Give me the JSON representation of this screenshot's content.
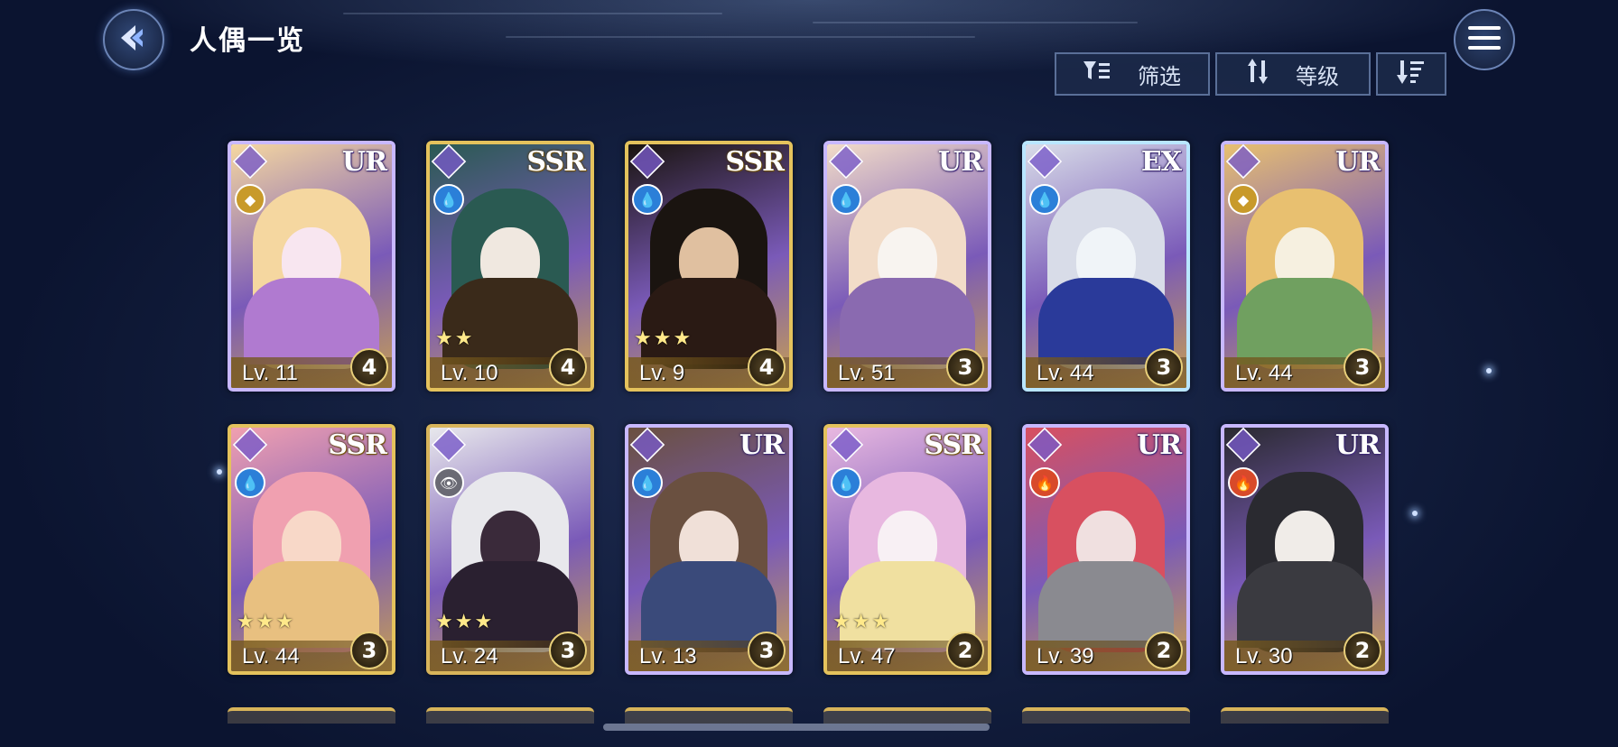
{
  "header": {
    "title": "人偶一览"
  },
  "toolbar": {
    "filter_label": "筛选",
    "sort_label": "等级"
  },
  "colors": {
    "accent": "#d8b45a",
    "background": "#142040"
  },
  "cards": [
    {
      "rarity": "UR",
      "level": "Lv. 11",
      "count": "4",
      "element": "none",
      "stars": ""
    },
    {
      "rarity": "SSR",
      "level": "Lv. 10",
      "count": "4",
      "element": "water",
      "stars": "★★"
    },
    {
      "rarity": "SSR",
      "level": "Lv. 9",
      "count": "4",
      "element": "water",
      "stars": "★★★"
    },
    {
      "rarity": "UR",
      "level": "Lv. 51",
      "count": "3",
      "element": "water",
      "stars": ""
    },
    {
      "rarity": "EX",
      "level": "Lv. 44",
      "count": "3",
      "element": "water",
      "stars": ""
    },
    {
      "rarity": "UR",
      "level": "Lv. 44",
      "count": "3",
      "element": "none",
      "stars": ""
    },
    {
      "rarity": "SSR",
      "level": "Lv. 44",
      "count": "3",
      "element": "water",
      "stars": "★★★"
    },
    {
      "rarity": "",
      "level": "Lv. 24",
      "count": "3",
      "element": "dark",
      "stars": "★★★"
    },
    {
      "rarity": "UR",
      "level": "Lv. 13",
      "count": "3",
      "element": "water",
      "stars": ""
    },
    {
      "rarity": "SSR",
      "level": "Lv. 47",
      "count": "2",
      "element": "water",
      "stars": "★★★"
    },
    {
      "rarity": "UR",
      "level": "Lv. 39",
      "count": "2",
      "element": "fire",
      "stars": ""
    },
    {
      "rarity": "UR",
      "level": "Lv. 30",
      "count": "2",
      "element": "fire",
      "stars": ""
    }
  ]
}
